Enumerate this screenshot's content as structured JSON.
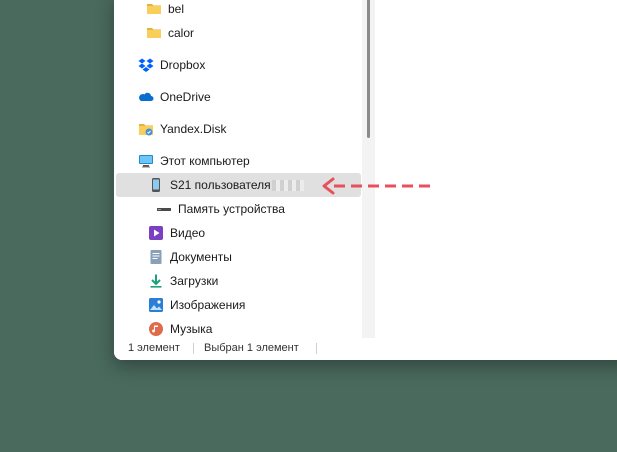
{
  "nav": {
    "items": [
      {
        "label": "bel",
        "icon": "folder-icon"
      },
      {
        "label": "calor",
        "icon": "folder-icon"
      },
      {
        "label": "Dropbox",
        "icon": "dropbox-icon"
      },
      {
        "label": "OneDrive",
        "icon": "onedrive-icon"
      },
      {
        "label": "Yandex.Disk",
        "icon": "yandex-disk-icon"
      },
      {
        "label": "Этот компьютер",
        "icon": "computer-icon"
      },
      {
        "label": "S21 пользователя",
        "icon": "phone-icon",
        "selected": true
      },
      {
        "label": "Память устройства",
        "icon": "drive-icon"
      },
      {
        "label": "Видео",
        "icon": "video-icon"
      },
      {
        "label": "Документы",
        "icon": "documents-icon"
      },
      {
        "label": "Загрузки",
        "icon": "downloads-icon"
      },
      {
        "label": "Изображения",
        "icon": "pictures-icon"
      },
      {
        "label": "Музыка",
        "icon": "music-icon"
      }
    ]
  },
  "status": {
    "count": "1 элемент",
    "selected": "Выбран 1 элемент"
  },
  "colors": {
    "desktop": "#4a6a5e",
    "folder": "#f4c542",
    "dropbox": "#0061fe",
    "onedrive": "#0a6ed1",
    "arrow": "#e8505b"
  }
}
